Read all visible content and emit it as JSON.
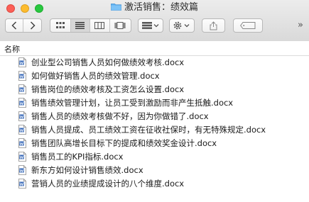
{
  "window": {
    "title": "激活销售：绩效篇"
  },
  "toolbar": {
    "more": "»"
  },
  "list_header": {
    "name_column": "名称"
  },
  "files": [
    "创业型公司销售人员如何做绩效考核.docx",
    "如何做好销售人员的绩效管理.docx",
    "销售岗位的绩效考核及工资怎么设置.docx",
    "销售绩效管理计划，让员工受到激励而非产生抵触.docx",
    "销售人员的绩效考核做不好，因为你做错了.docx",
    "销售人员提成、员工绩效工资在征收社保时，有无特殊规定.docx",
    "销售团队高增长目标下的提成和绩效奖金设计.docx",
    "销售员工的KPI指标.docx",
    "新东方如何设计销售绩效.docx",
    "营销人员的业绩提成设计的八个维度.docx"
  ]
}
